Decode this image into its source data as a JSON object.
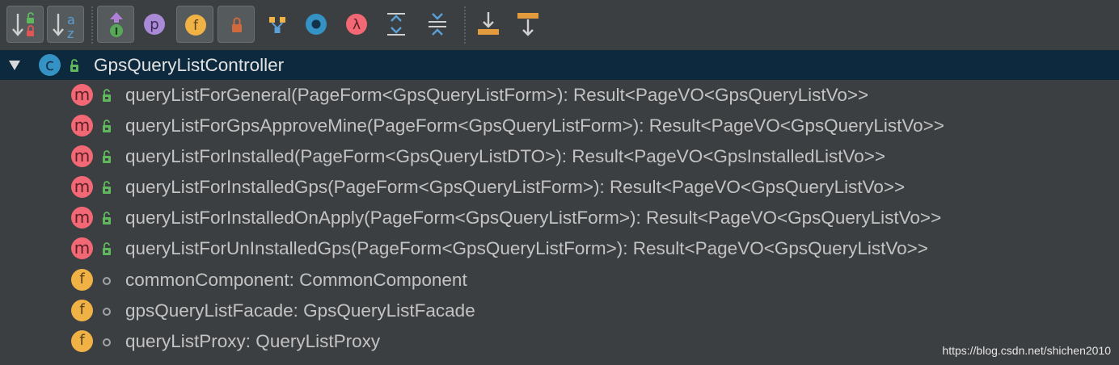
{
  "toolbar": {
    "buttons": [
      {
        "name": "sort-by-visibility-button",
        "toggled": true
      },
      {
        "name": "sort-alphabetically-button",
        "toggled": true,
        "letters": [
          "a",
          "z"
        ]
      },
      {
        "name": "show-inherited-button",
        "toggled": true
      },
      {
        "name": "show-properties-button",
        "toggled": false,
        "letter": "p"
      },
      {
        "name": "show-fields-button",
        "toggled": true,
        "letter": "f"
      },
      {
        "name": "show-non-public-button",
        "toggled": true
      },
      {
        "name": "group-methods-button",
        "toggled": false
      },
      {
        "name": "show-anonymous-button",
        "toggled": false
      },
      {
        "name": "show-lambdas-button",
        "toggled": false,
        "letter": "λ"
      },
      {
        "name": "expand-all-button",
        "toggled": false
      },
      {
        "name": "collapse-all-button",
        "toggled": false
      },
      {
        "name": "autoscroll-to-source-button",
        "toggled": false
      },
      {
        "name": "autoscroll-from-source-button",
        "toggled": false
      }
    ]
  },
  "tree": {
    "root": {
      "kind_letter": "c",
      "label": "GpsQueryListController",
      "expanded": true,
      "selected": true
    },
    "members": [
      {
        "kind_letter": "m",
        "visibility": "public",
        "label": "queryListForGeneral(PageForm<GpsQueryListForm>): Result<PageVO<GpsQueryListVo>>"
      },
      {
        "kind_letter": "m",
        "visibility": "public",
        "label": "queryListForGpsApproveMine(PageForm<GpsQueryListForm>): Result<PageVO<GpsQueryListVo>>"
      },
      {
        "kind_letter": "m",
        "visibility": "public",
        "label": "queryListForInstalled(PageForm<GpsQueryListDTO>): Result<PageVO<GpsInstalledListVo>>"
      },
      {
        "kind_letter": "m",
        "visibility": "public",
        "label": "queryListForInstalledGps(PageForm<GpsQueryListForm>): Result<PageVO<GpsQueryListVo>>"
      },
      {
        "kind_letter": "m",
        "visibility": "public",
        "label": "queryListForInstalledOnApply(PageForm<GpsQueryListForm>): Result<PageVO<GpsQueryListVo>>"
      },
      {
        "kind_letter": "m",
        "visibility": "public",
        "label": "queryListForUnInstalledGps(PageForm<GpsQueryListForm>): Result<PageVO<GpsQueryListVo>>"
      },
      {
        "kind_letter": "f",
        "visibility": "package-private",
        "label": "commonComponent: CommonComponent"
      },
      {
        "kind_letter": "f",
        "visibility": "package-private",
        "label": "gpsQueryListFacade: GpsQueryListFacade"
      },
      {
        "kind_letter": "f",
        "visibility": "package-private",
        "label": "queryListProxy: QueryListProxy"
      }
    ]
  },
  "watermark": "https://blog.csdn.net/shichen2010",
  "colors": {
    "background": "#3c3f41",
    "selection": "#0d293e",
    "class_badge": "#3592c4",
    "method_badge": "#f26875",
    "field_badge": "#f0b245",
    "public_lock": "#5fb85b",
    "text": "#c3c3c3"
  }
}
